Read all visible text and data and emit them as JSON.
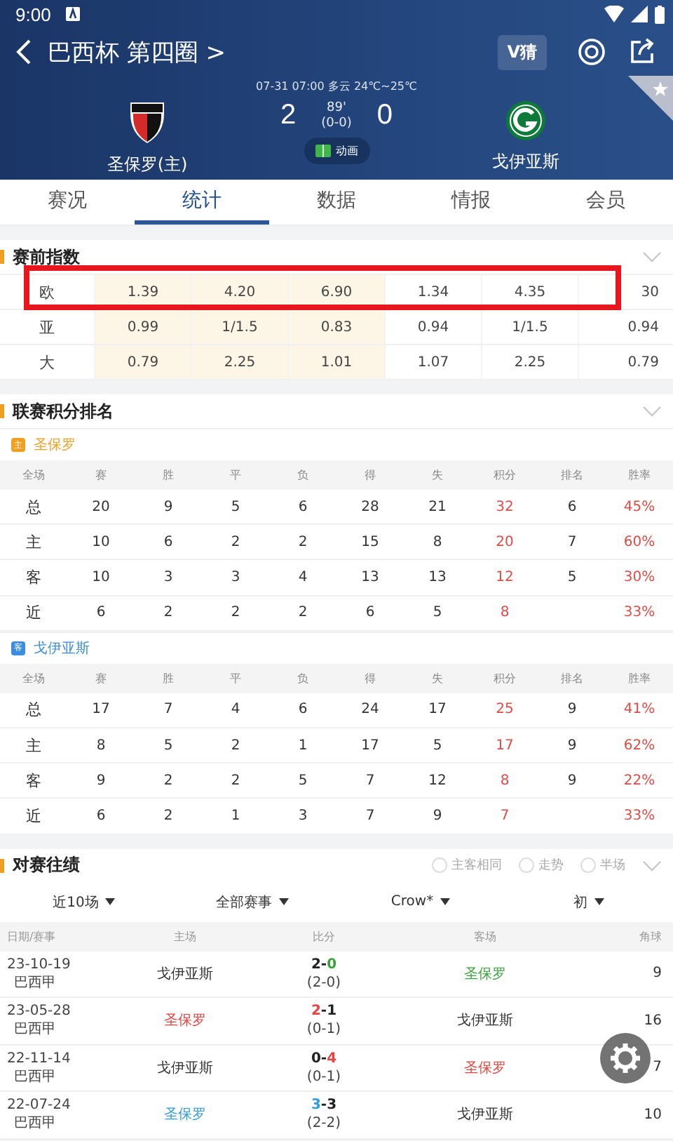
{
  "status_bar": {
    "time": "9:00"
  },
  "header": {
    "title": "巴西杯 第四圈 >",
    "vip_button": "V猜",
    "match_info": "07-31 07:00   多云 24℃~25℃",
    "home": {
      "name": "圣保罗(主)"
    },
    "away": {
      "name": "戈伊亚斯"
    },
    "home_score": "2",
    "away_score": "0",
    "minute": "89'",
    "half_score": "(0-0)",
    "animation_label": "动画",
    "favorite": false
  },
  "tabs": [
    {
      "label": "赛况",
      "selected": false
    },
    {
      "label": "统计",
      "selected": true
    },
    {
      "label": "数据",
      "selected": false
    },
    {
      "label": "情报",
      "selected": false
    },
    {
      "label": "会员",
      "selected": false
    }
  ],
  "odds": {
    "title": "赛前指数",
    "rows": [
      {
        "label": "欧",
        "highlighted": true,
        "values": [
          "1.39",
          "4.20",
          "6.90",
          "1.34",
          "4.35",
          "30"
        ]
      },
      {
        "label": "亚",
        "highlighted": false,
        "values": [
          "0.99",
          "1/1.5",
          "0.83",
          "0.94",
          "1/1.5",
          "0.94"
        ]
      },
      {
        "label": "大",
        "highlighted": false,
        "values": [
          "0.79",
          "2.25",
          "1.01",
          "1.07",
          "2.25",
          "0.79"
        ]
      }
    ]
  },
  "standings": {
    "title": "联赛积分排名",
    "teams": [
      {
        "badge": "主",
        "kind": "home",
        "name": "圣保罗",
        "columns": [
          "全场",
          "赛",
          "胜",
          "平",
          "负",
          "得",
          "失",
          "积分",
          "排名",
          "胜率"
        ],
        "rows": [
          [
            "总",
            "20",
            "9",
            "5",
            "6",
            "28",
            "21",
            "32",
            "6",
            "45%"
          ],
          [
            "主",
            "10",
            "6",
            "2",
            "2",
            "15",
            "8",
            "20",
            "7",
            "60%"
          ],
          [
            "客",
            "10",
            "3",
            "3",
            "4",
            "13",
            "13",
            "12",
            "5",
            "30%"
          ],
          [
            "近",
            "6",
            "2",
            "2",
            "2",
            "6",
            "5",
            "8",
            "",
            "33%"
          ]
        ]
      },
      {
        "badge": "客",
        "kind": "away",
        "name": "戈伊亚斯",
        "columns": [
          "全场",
          "赛",
          "胜",
          "平",
          "负",
          "得",
          "失",
          "积分",
          "排名",
          "胜率"
        ],
        "rows": [
          [
            "总",
            "17",
            "7",
            "4",
            "6",
            "24",
            "17",
            "25",
            "9",
            "41%"
          ],
          [
            "主",
            "8",
            "5",
            "2",
            "1",
            "17",
            "5",
            "17",
            "9",
            "62%"
          ],
          [
            "客",
            "9",
            "2",
            "2",
            "5",
            "7",
            "12",
            "8",
            "9",
            "22%"
          ],
          [
            "近",
            "6",
            "2",
            "1",
            "3",
            "7",
            "9",
            "7",
            "",
            "33%"
          ]
        ]
      }
    ]
  },
  "head_to_head": {
    "title": "对赛往绩",
    "options": [
      {
        "label": "主客相同",
        "checked": false
      },
      {
        "label": "走势",
        "checked": false
      },
      {
        "label": "半场",
        "checked": false
      }
    ],
    "filters": [
      "近10场",
      "全部赛事",
      "Crow*",
      "初"
    ],
    "columns": [
      "日期/赛事",
      "主场",
      "比分",
      "客场",
      "角球"
    ],
    "matches": [
      {
        "date": "23-10-19",
        "league": "巴西甲",
        "home": {
          "name": "戈伊亚斯",
          "color": "#333333"
        },
        "away": {
          "name": "圣保罗",
          "color": "#3aa23a"
        },
        "score": {
          "home": {
            "text": "2",
            "color": "#222222"
          },
          "separator": "-",
          "away": {
            "text": "0",
            "color": "#3aa23a"
          }
        },
        "half": "(2-0)",
        "corners": "9"
      },
      {
        "date": "23-05-28",
        "league": "巴西甲",
        "home": {
          "name": "圣保罗",
          "color": "#e8433e"
        },
        "away": {
          "name": "戈伊亚斯",
          "color": "#333333"
        },
        "score": {
          "home": {
            "text": "2",
            "color": "#e8433e"
          },
          "separator": "-",
          "away": {
            "text": "1",
            "color": "#222222"
          }
        },
        "half": "(0-1)",
        "corners": "16"
      },
      {
        "date": "22-11-14",
        "league": "巴西甲",
        "home": {
          "name": "戈伊亚斯",
          "color": "#333333"
        },
        "away": {
          "name": "圣保罗",
          "color": "#e8433e"
        },
        "score": {
          "home": {
            "text": "0",
            "color": "#222222"
          },
          "separator": "-",
          "away": {
            "text": "4",
            "color": "#e8433e"
          }
        },
        "half": "(0-1)",
        "corners": "7"
      },
      {
        "date": "22-07-24",
        "league": "巴西甲",
        "home": {
          "name": "圣保罗",
          "color": "#2f9be0"
        },
        "away": {
          "name": "戈伊亚斯",
          "color": "#333333"
        },
        "score": {
          "home": {
            "text": "3",
            "color": "#2f9be0"
          },
          "separator": "-",
          "away": {
            "text": "3",
            "color": "#222222"
          }
        },
        "half": "(2-2)",
        "corners": "10"
      }
    ]
  }
}
